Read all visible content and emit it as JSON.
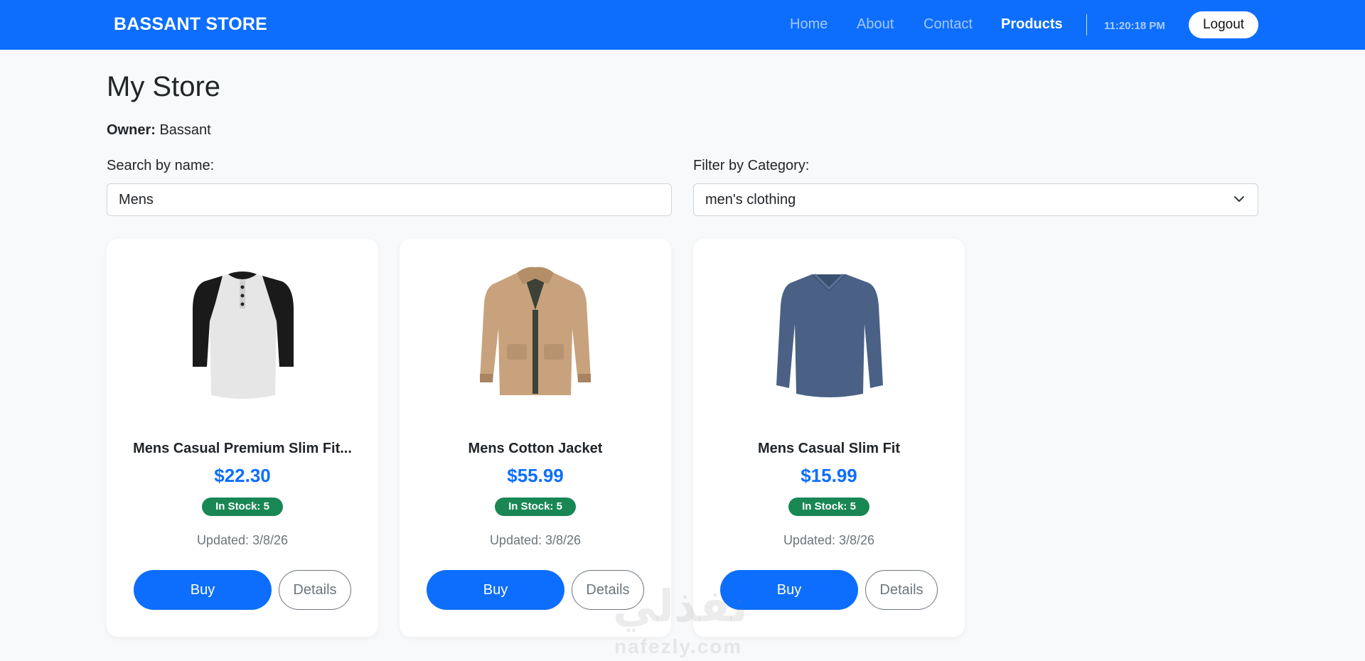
{
  "navbar": {
    "brand": "BASSANT STORE",
    "links": [
      {
        "label": "Home",
        "active": false
      },
      {
        "label": "About",
        "active": false
      },
      {
        "label": "Contact",
        "active": false
      },
      {
        "label": "Products",
        "active": true
      }
    ],
    "clock": "11:20:18 PM",
    "logout_label": "Logout"
  },
  "page": {
    "title": "My Store",
    "owner_label": "Owner:",
    "owner_name": "Bassant"
  },
  "search": {
    "label": "Search by name:",
    "value": "Mens"
  },
  "filter": {
    "label": "Filter by Category:",
    "selected": "men's clothing"
  },
  "products": [
    {
      "title": "Mens Casual Premium Slim Fit...",
      "price": "$22.30",
      "stock": "In Stock: 5",
      "updated": "Updated: 3/8/26",
      "buy_label": "Buy",
      "details_label": "Details",
      "image_icon": "raglan-henley-shirt-icon"
    },
    {
      "title": "Mens Cotton Jacket",
      "price": "$55.99",
      "stock": "In Stock: 5",
      "updated": "Updated: 3/8/26",
      "buy_label": "Buy",
      "details_label": "Details",
      "image_icon": "cotton-jacket-icon"
    },
    {
      "title": "Mens Casual Slim Fit",
      "price": "$15.99",
      "stock": "In Stock: 5",
      "updated": "Updated: 3/8/26",
      "buy_label": "Buy",
      "details_label": "Details",
      "image_icon": "long-sleeve-tshirt-icon"
    }
  ],
  "watermark": {
    "word": "نفذلي",
    "url": "nafezly.com"
  },
  "colors": {
    "primary": "#0d6efd",
    "success": "#198754",
    "background": "#f8f9fa",
    "muted": "#6c757d"
  }
}
